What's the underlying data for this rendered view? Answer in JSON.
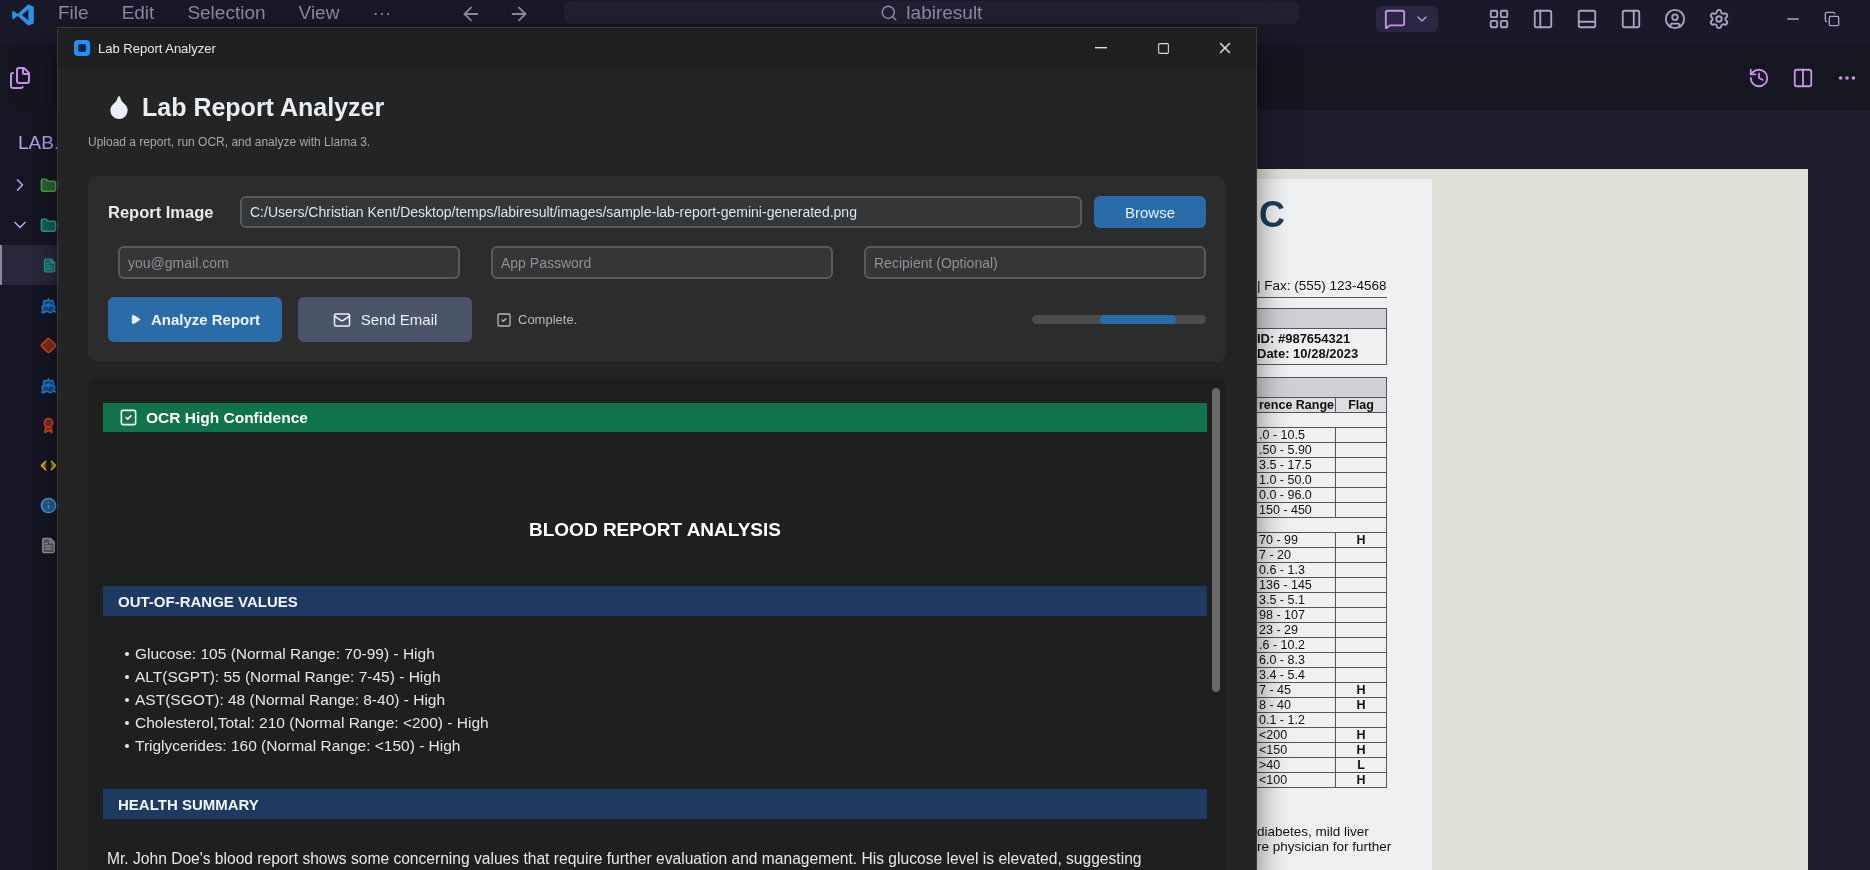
{
  "editor": {
    "menu": [
      "File",
      "Edit",
      "Selection",
      "View",
      "···"
    ],
    "search": {
      "value": "labiresult"
    },
    "explorer": {
      "title": "LAB.",
      "items": [
        {
          "kind": "folder",
          "expanded": false,
          "selected": false
        },
        {
          "kind": "folder",
          "expanded": true,
          "selected": false
        },
        {
          "kind": "file",
          "selected": true
        },
        {
          "kind": "file",
          "selected": false
        },
        {
          "kind": "file",
          "selected": false
        },
        {
          "kind": "file",
          "selected": false
        },
        {
          "kind": "file",
          "selected": false
        },
        {
          "kind": "file",
          "selected": false
        },
        {
          "kind": "file",
          "selected": false
        },
        {
          "kind": "file",
          "selected": false
        }
      ]
    },
    "image_preview": {
      "logo_letter": "C",
      "contact": "| Fax: (555) 123-4568",
      "info": [
        "ID: #987654321",
        "Date: 10/28/2023"
      ],
      "table": {
        "columns": [
          "rence Range",
          "Flag"
        ],
        "rows": [
          {
            "kind": "section"
          },
          {
            "kind": "row",
            "range": ".0 - 10.5",
            "flag": ""
          },
          {
            "kind": "row",
            "range": ".50 - 5.90",
            "flag": ""
          },
          {
            "kind": "row",
            "range": "3.5 - 17.5",
            "flag": ""
          },
          {
            "kind": "row",
            "range": "1.0 - 50.0",
            "flag": ""
          },
          {
            "kind": "row",
            "range": "0.0 - 96.0",
            "flag": ""
          },
          {
            "kind": "row",
            "range": "150 - 450",
            "flag": ""
          },
          {
            "kind": "section"
          },
          {
            "kind": "row",
            "range": "70 - 99",
            "flag": "H"
          },
          {
            "kind": "row",
            "range": "7 - 20",
            "flag": ""
          },
          {
            "kind": "row",
            "range": "0.6 - 1.3",
            "flag": ""
          },
          {
            "kind": "row",
            "range": "136 - 145",
            "flag": ""
          },
          {
            "kind": "row",
            "range": "3.5 - 5.1",
            "flag": ""
          },
          {
            "kind": "row",
            "range": "98 - 107",
            "flag": ""
          },
          {
            "kind": "row",
            "range": "23 - 29",
            "flag": ""
          },
          {
            "kind": "row",
            "range": ".6 - 10.2",
            "flag": ""
          },
          {
            "kind": "row",
            "range": "6.0 - 8.3",
            "flag": ""
          },
          {
            "kind": "row",
            "range": "3.4 - 5.4",
            "flag": ""
          },
          {
            "kind": "row",
            "range": "7 - 45",
            "flag": "H"
          },
          {
            "kind": "row",
            "range": "8 - 40",
            "flag": "H"
          },
          {
            "kind": "row",
            "range": "0.1 - 1.2",
            "flag": ""
          },
          {
            "kind": "row",
            "range": "<200",
            "flag": "H"
          },
          {
            "kind": "row",
            "range": "<150",
            "flag": "H"
          },
          {
            "kind": "row",
            "range": ">40",
            "flag": "L"
          },
          {
            "kind": "row",
            "range": "<100",
            "flag": "H"
          }
        ]
      },
      "notes": [
        "diabetes, mild liver",
        "re physician for further"
      ]
    }
  },
  "app": {
    "window_title": "Lab Report Analyzer",
    "title": "Lab Report Analyzer",
    "subtitle": "Upload a report, run OCR, and analyze with Llama 3.",
    "report_image": {
      "label": "Report Image",
      "value": "C:/Users/Christian Kent/Desktop/temps/labiresult/images/sample-lab-report-gemini-generated.png"
    },
    "browse": "Browse",
    "fields": [
      {
        "placeholder": "you@gmail.com"
      },
      {
        "placeholder": "App Password"
      },
      {
        "placeholder": "Recipient (Optional)"
      }
    ],
    "actions": [
      {
        "kind": "primary",
        "label": "Analyze Report"
      },
      {
        "kind": "secondary",
        "label": "Send Email"
      }
    ],
    "status": {
      "label": "Complete.",
      "checked": true
    },
    "progress": {
      "indeterminate": true
    },
    "results": {
      "ocr_banner": {
        "label": "OCR High Confidence",
        "checked": true
      },
      "heading": "BLOOD REPORT ANALYSIS",
      "sections": [
        {
          "title": "OUT-OF-RANGE VALUES",
          "items": [
            "Glucose: 105 (Normal Range: 70-99) - High",
            "ALT(SGPT): 55 (Normal Range: 7-45) - High",
            "AST(SGOT): 48 (Normal Range: 8-40) - High",
            "Cholesterol,Total: 210 (Normal Range: <200) - High",
            "Triglycerides: 160 (Normal Range: <150) - High"
          ]
        },
        {
          "title": "HEALTH SUMMARY",
          "paragraph": "Mr. John Doe's blood report shows some concerning values that require further evaluation and management. His glucose level is elevated, suggesting"
        }
      ]
    }
  }
}
